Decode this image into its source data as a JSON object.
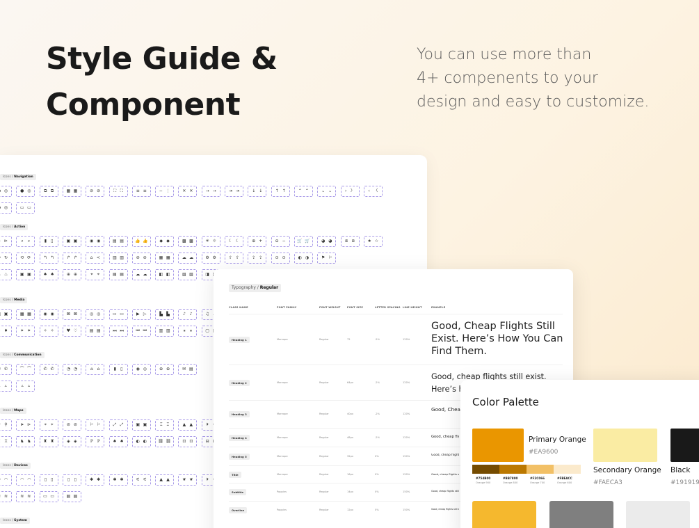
{
  "hero": {
    "title_line1": "Style Guide &",
    "title_line2": "Component",
    "subtitle_line1": "You can use more than",
    "subtitle_line2": "4+ compenents to your",
    "subtitle_line3": "design and easy to customize."
  },
  "icons_card": {
    "sections": [
      {
        "prefix": "Icons / ",
        "name": "Navigation",
        "rows": [
          [
            "●◎",
            "●◎",
            "⧉⧉",
            "▦▦",
            "⊘⊘",
            "⛶⛶",
            "≡≡",
            "−⋮",
            "✕✕",
            "→→",
            "⇥⇥",
            "↓↓",
            "↑↑",
            "⌃⌃",
            "⌄⌄",
            "›〉",
            "‹〈"
          ],
          [
            "●◎",
            "▭▭"
          ]
        ]
      },
      {
        "prefix": "Icons / ",
        "name": "Action",
        "rows": [
          [
            "➤⊳",
            "⌕⌕",
            "▮▯",
            "▣▣",
            "◉◉",
            "▤▤",
            "👍👍",
            "◆◆",
            "▩▩",
            "✳☼",
            "☾☾",
            "⊕+",
            "⊖−",
            "🛒🛒",
            "◕◕",
            "⧈⧈",
            "★☆"
          ],
          [
            "↻↻",
            "⟲⟳",
            "↰↰",
            "↱↱",
            "⌂≺",
            "▥▥",
            "⊘⊘",
            "▦▦",
            "☁☁",
            "⚙⚙",
            "⇧⇧",
            "⇪⇪",
            "⊙⊙",
            "◐◑",
            "⚑⚐"
          ],
          [
            "♨♨",
            "▣▣",
            "♠♠",
            "⊕⊕",
            "⌖⌖",
            "▤▤",
            "☁☁",
            "◧◧",
            "▧▧",
            "◨◨",
            "⚡⚡"
          ]
        ]
      },
      {
        "prefix": "Icons / ",
        "name": "Media",
        "rows": [
          [
            "▣▣",
            "▦▦",
            "◉◉",
            "⊠⊠",
            "◎◎",
            "▭▭",
            "▶▷",
            "▙▙",
            "♪♪",
            "♫♫"
          ],
          [
            "♦♦",
            "✦✦",
            "✧✧",
            "♥♡",
            "▤▤",
            "⏭⏭",
            "⏮⏮",
            "▥▥",
            "⏸⏸",
            "▢▢"
          ]
        ]
      },
      {
        "prefix": "Icons / ",
        "name": "Communication",
        "rows": [
          [
            "✆✆",
            "⌒⌒",
            "✆✆",
            "◔◔",
            "⌂⌂",
            "▮▯",
            "◉◎",
            "⊕⊕",
            "✉▤"
          ],
          [
            "▵▵",
            "▵▵"
          ]
        ]
      },
      {
        "prefix": "Icons / ",
        "name": "Maps",
        "rows": [
          [
            "⚲⚲",
            "➤⊳",
            "⌖⌖",
            "⊘⊘",
            "⚐⚐",
            "⤢⤢",
            "▣▣",
            "⌶⌶",
            "▲▲",
            "✈✈"
          ],
          [
            "♖♖",
            "♞♞",
            "♜♜",
            "◈◈",
            "ℙℙ",
            "♠♠",
            "◐◐",
            "⛓⛓",
            "⊡⊡",
            "⊟⊟"
          ]
        ]
      },
      {
        "prefix": "Icons / ",
        "name": "Devices",
        "rows": [
          [
            "◠◠",
            "◠◠",
            "▯▯",
            "▯▯",
            "✱✱",
            "✱✱",
            "⚟⚟",
            "▲▲",
            "❦❦",
            "✈✈"
          ],
          [
            "≋≋",
            "≋≋",
            "▭▭",
            "▤▤"
          ]
        ]
      },
      {
        "prefix": "Icons / ",
        "name": "System",
        "rows": []
      }
    ]
  },
  "typography": {
    "tag_prefix": "Typography / ",
    "tag_name": "Regular",
    "headers": [
      "CLASS NAME",
      "FONT FAMILY",
      "FONT WEIGHT",
      "FONT SIZE",
      "LETTER SPACING",
      "LINE HEIGHT",
      "EXAMPLE"
    ],
    "rows": [
      {
        "name": "Heading 1",
        "family": "Manrope",
        "weight": "Regular",
        "size": "72",
        "spacing": "-2%",
        "line": "120%",
        "example": "Good, Cheap Flights Still Exist. Here’s How You Can Find Them."
      },
      {
        "name": "Heading 2",
        "family": "Manrope",
        "weight": "Regular",
        "size": "64px",
        "spacing": "-2%",
        "line": "120%",
        "example": "Good, cheap flights still exist. Here’s how you can find them."
      },
      {
        "name": "Heading 3",
        "family": "Manrope",
        "weight": "Regular",
        "size": "40px",
        "spacing": "-2%",
        "line": "120%",
        "example": "Good, Cheap Flights Still Exist. Here’s How You Can Find Them."
      },
      {
        "name": "Heading 4",
        "family": "Manrope",
        "weight": "Regular",
        "size": "48px",
        "spacing": "-2%",
        "line": "120%",
        "example": "Good, cheap flights still exist. Here’s how you can find them."
      },
      {
        "name": "Heading 5",
        "family": "Manrope",
        "weight": "Regular",
        "size": "32px",
        "spacing": "0%",
        "line": "150%",
        "example": "Good, cheap flights still exist. Here’s how you can find them."
      },
      {
        "name": "Title",
        "family": "Manrope",
        "weight": "Regular",
        "size": "16px",
        "spacing": "0%",
        "line": "150%",
        "example": "Good, cheap flights still exist. Here’s how you can find them."
      },
      {
        "name": "Subtitle",
        "family": "Poppins",
        "weight": "Regular",
        "size": "14px",
        "spacing": "0%",
        "line": "150%",
        "example": "Good, cheap flights still exist. Here’s how you can find them."
      },
      {
        "name": "Overline",
        "family": "Poppins",
        "weight": "Regular",
        "size": "12px",
        "spacing": "0%",
        "line": "150%",
        "example": "Good, cheap flights still exist. Here’s how you can find them."
      }
    ]
  },
  "palette": {
    "title": "Color Palette",
    "primary": {
      "name": "Primary Orange",
      "hex": "#EA9600",
      "color": "#EA9600"
    },
    "shades": [
      {
        "hex": "#754B00",
        "name": "Orange 900",
        "color": "#754B00"
      },
      {
        "hex": "#BB7800",
        "name": "Orange 800",
        "color": "#BB7800"
      },
      {
        "hex": "#F2C066",
        "name": "Orange 700",
        "color": "#F2C066"
      },
      {
        "hex": "#FBEACC",
        "name": "Orange 600",
        "color": "#FBEACC"
      }
    ],
    "secondary": {
      "name": "Secondary Orange",
      "hex": "#FAECA3",
      "color": "#FAECA3"
    },
    "black": {
      "name": "Black",
      "hex": "#191919",
      "color": "#191919"
    },
    "bottom_colors": [
      "#F5B82E",
      "#7F7F7F",
      "#EBEBEB"
    ]
  }
}
